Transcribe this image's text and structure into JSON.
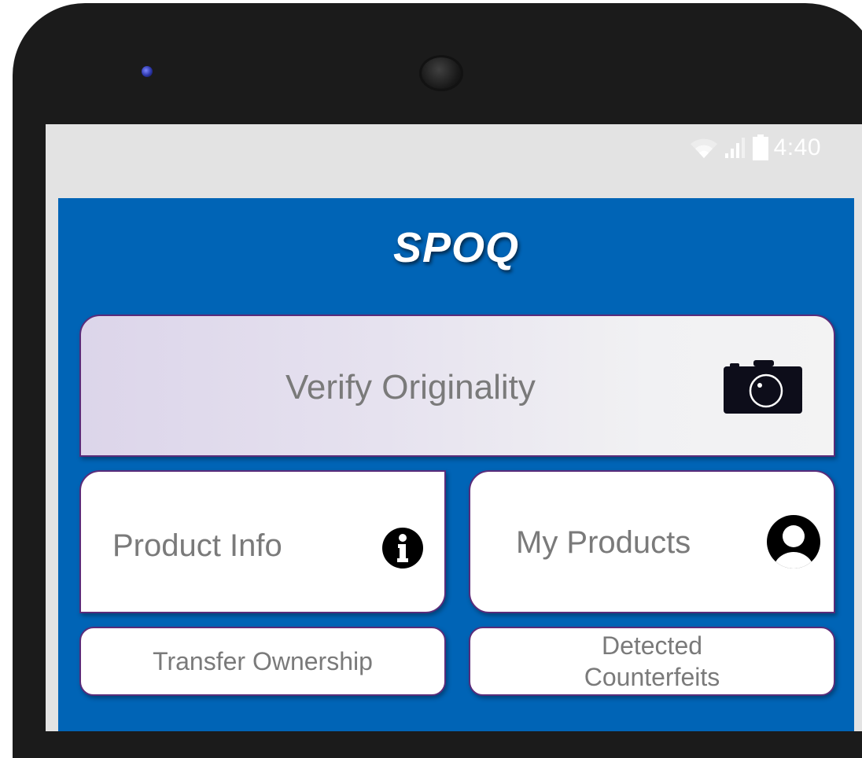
{
  "status_bar": {
    "time": "4:40",
    "icons": [
      "wifi-icon",
      "cell-signal-icon",
      "battery-icon"
    ]
  },
  "app": {
    "title": "SPOQ"
  },
  "menu": {
    "verify_originality": {
      "label": "Verify Originality",
      "icon": "camera-icon"
    },
    "product_info": {
      "label": "Product Info",
      "icon": "info-icon"
    },
    "my_products": {
      "label": "My Products",
      "icon": "user-icon"
    },
    "transfer_ownership": {
      "label": "Transfer Ownership"
    },
    "detected_counterfeits": {
      "label_line1": "Detected",
      "label_line2": "Counterfeits"
    }
  },
  "colors": {
    "app_background": "#0064b6",
    "card_border": "#5a2c7a",
    "label_text": "#7a7a7a",
    "phone_frame": "#1b1b1b",
    "status_bar_bg": "#e3e3e3"
  }
}
